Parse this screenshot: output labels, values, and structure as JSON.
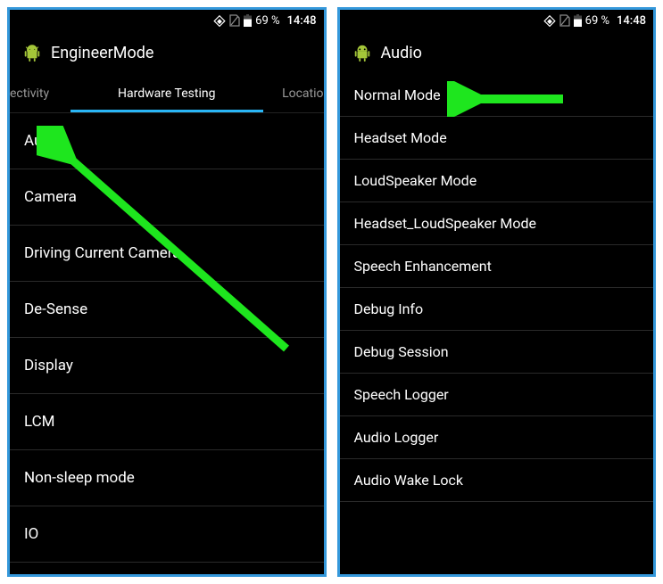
{
  "status": {
    "battery_pct": "69 %",
    "time": "14:48"
  },
  "screen_a": {
    "app_title": "EngineerMode",
    "tabs": {
      "left": "ectivity",
      "center": "Hardware Testing",
      "right": "Locatio"
    },
    "items": [
      "Audio",
      "Camera",
      "Driving Current Camera",
      "De-Sense",
      "Display",
      "LCM",
      "Non-sleep mode",
      "IO"
    ]
  },
  "screen_b": {
    "app_title": "Audio",
    "items": [
      "Normal Mode",
      "Headset Mode",
      "LoudSpeaker Mode",
      "Headset_LoudSpeaker Mode",
      "Speech Enhancement",
      "Debug Info",
      "Debug Session",
      "Speech Logger",
      "Audio Logger",
      "Audio Wake Lock"
    ]
  }
}
